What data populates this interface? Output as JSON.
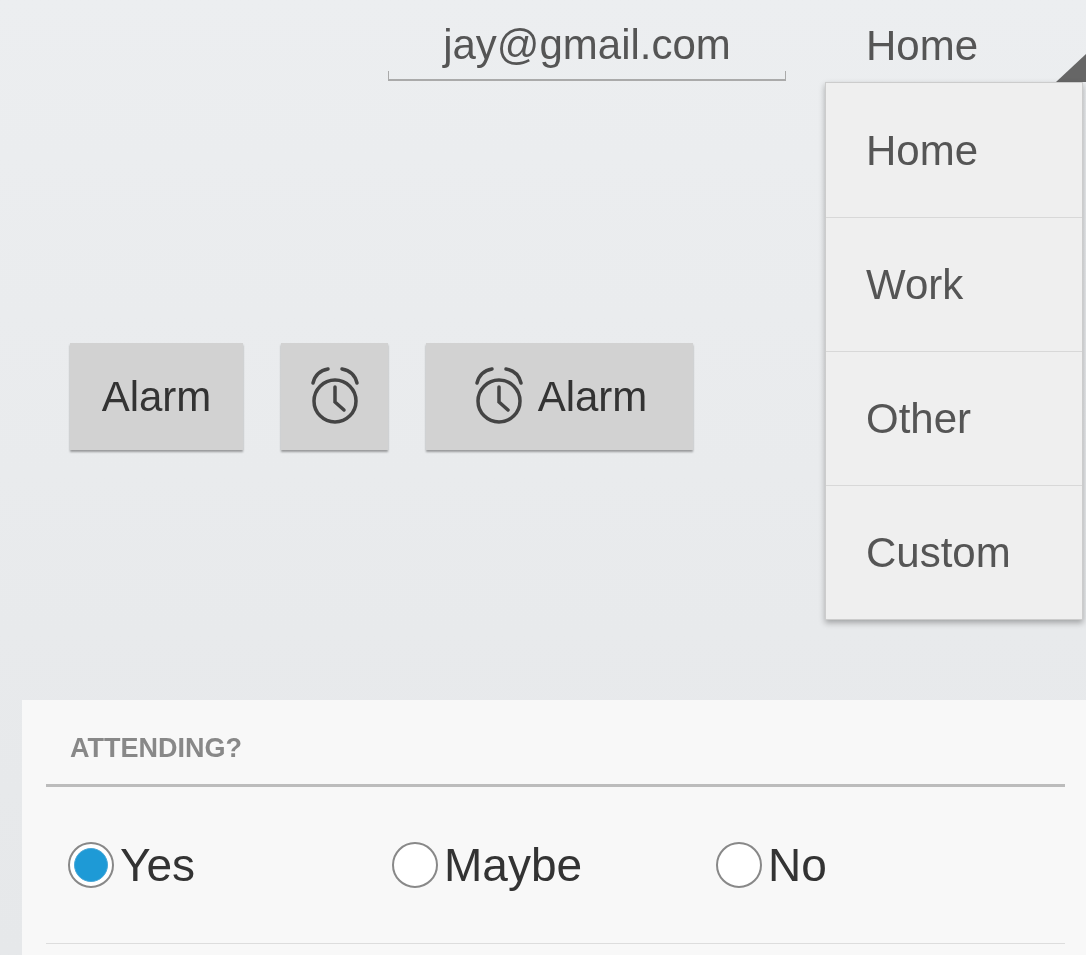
{
  "email_field": {
    "value": "jay@gmail.com"
  },
  "spinner": {
    "value": "Home",
    "expanded": true
  },
  "dropdown": {
    "items": [
      {
        "label": "Home"
      },
      {
        "label": "Work"
      },
      {
        "label": "Other"
      },
      {
        "label": "Custom"
      }
    ]
  },
  "buttons": [
    {
      "kind": "text",
      "label": "Alarm"
    },
    {
      "kind": "icon"
    },
    {
      "kind": "icon_text",
      "label": "Alarm"
    }
  ],
  "attending": {
    "title": "ATTENDING?",
    "options": [
      {
        "label": "Yes",
        "selected": true
      },
      {
        "label": "Maybe",
        "selected": false
      },
      {
        "label": "No",
        "selected": false
      }
    ]
  }
}
